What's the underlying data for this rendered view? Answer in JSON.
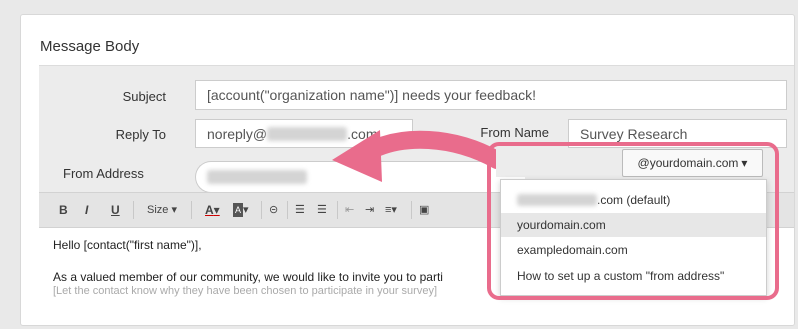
{
  "section_title": "Message Body",
  "form": {
    "subject_label": "Subject",
    "subject_value": "[account(\"organization name\")] needs your feedback!",
    "reply_to_label": "Reply To",
    "reply_to_prefix": "noreply@",
    "reply_to_suffix": ".com",
    "from_name_label": "From Name",
    "from_name_value": "Survey Research",
    "from_address_label": "From Address",
    "domain_selected": "@yourdomain.com"
  },
  "toolbar": {
    "bold": "B",
    "italic": "I",
    "underline": "U",
    "size": "Size",
    "font_color": "A",
    "bg_color": "A"
  },
  "editor": {
    "line1": "Hello [contact(\"first name\")],",
    "line2": "As a valued member of our community, we would like to invite you to parti",
    "line3": "[Let the contact know why they have been chosen to participate in your survey]"
  },
  "dropdown": {
    "items": [
      {
        "label": ".com (default)"
      },
      {
        "label": "yourdomain.com"
      },
      {
        "label": "exampledomain.com"
      },
      {
        "label": "How to set up a custom \"from address\""
      }
    ],
    "selected_index": 1
  },
  "colors": {
    "highlight": "#e96c8c",
    "arrow": "#e96c8c"
  }
}
